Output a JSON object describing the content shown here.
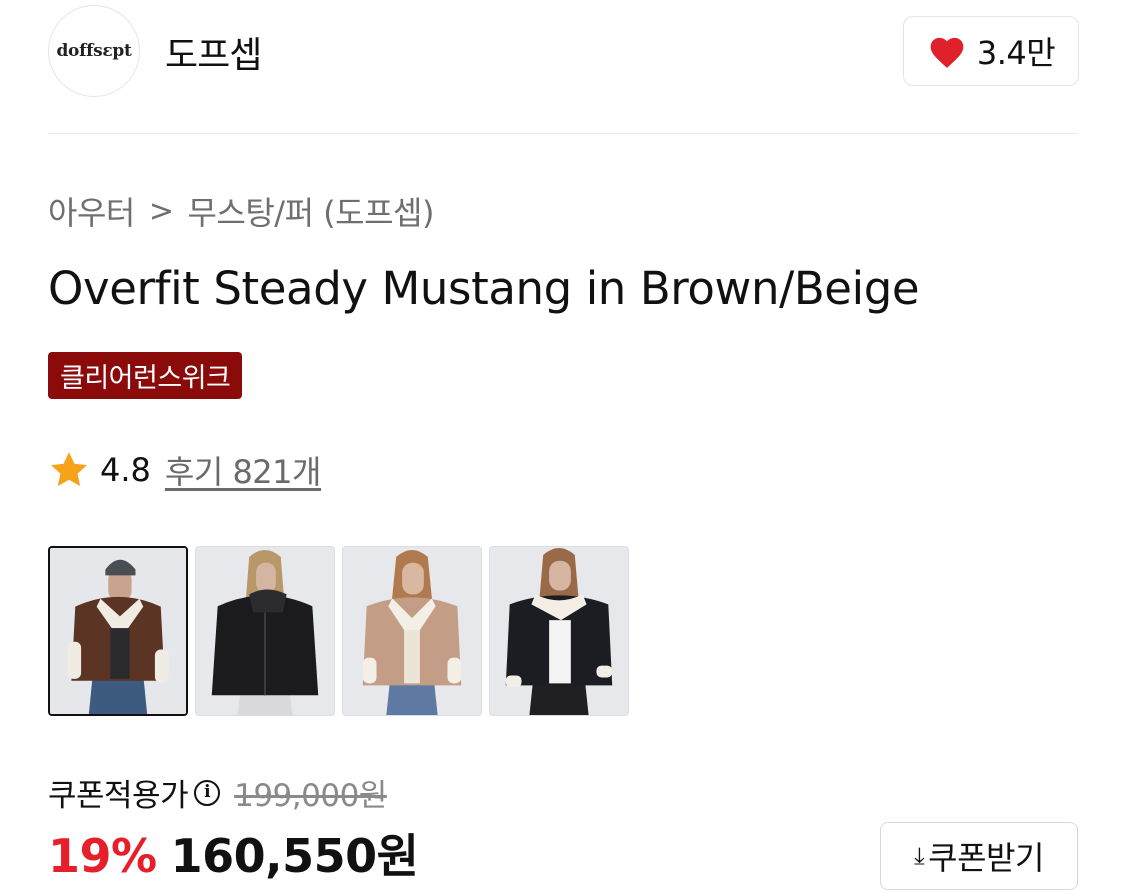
{
  "brand": {
    "logo_text": "doffsɛpt",
    "name": "도프셉",
    "like_count": "3.4만"
  },
  "breadcrumb": {
    "category": "아우터",
    "separator": ">",
    "subcategory": "무스탕/퍼 (도프셉)"
  },
  "product": {
    "title": "Overfit Steady Mustang in Brown/Beige",
    "badge": "클리어런스위크"
  },
  "rating": {
    "score": "4.8",
    "reviews_label": "후기 821개"
  },
  "thumbnails": [
    {
      "color": "brown",
      "selected": true
    },
    {
      "color": "black",
      "selected": false
    },
    {
      "color": "beige",
      "selected": false
    },
    {
      "color": "black",
      "selected": false
    }
  ],
  "price": {
    "label": "쿠폰적용가",
    "info_icon": "i",
    "original": "199,000원",
    "discount": "19%",
    "sale": "160,550원"
  },
  "coupon": {
    "icon": "⤓",
    "label": "쿠폰받기"
  },
  "colors": {
    "heart": "#e0202a",
    "star": "#f7a21b",
    "badge_bg": "#8b0a0a",
    "discount": "#e5202b"
  }
}
